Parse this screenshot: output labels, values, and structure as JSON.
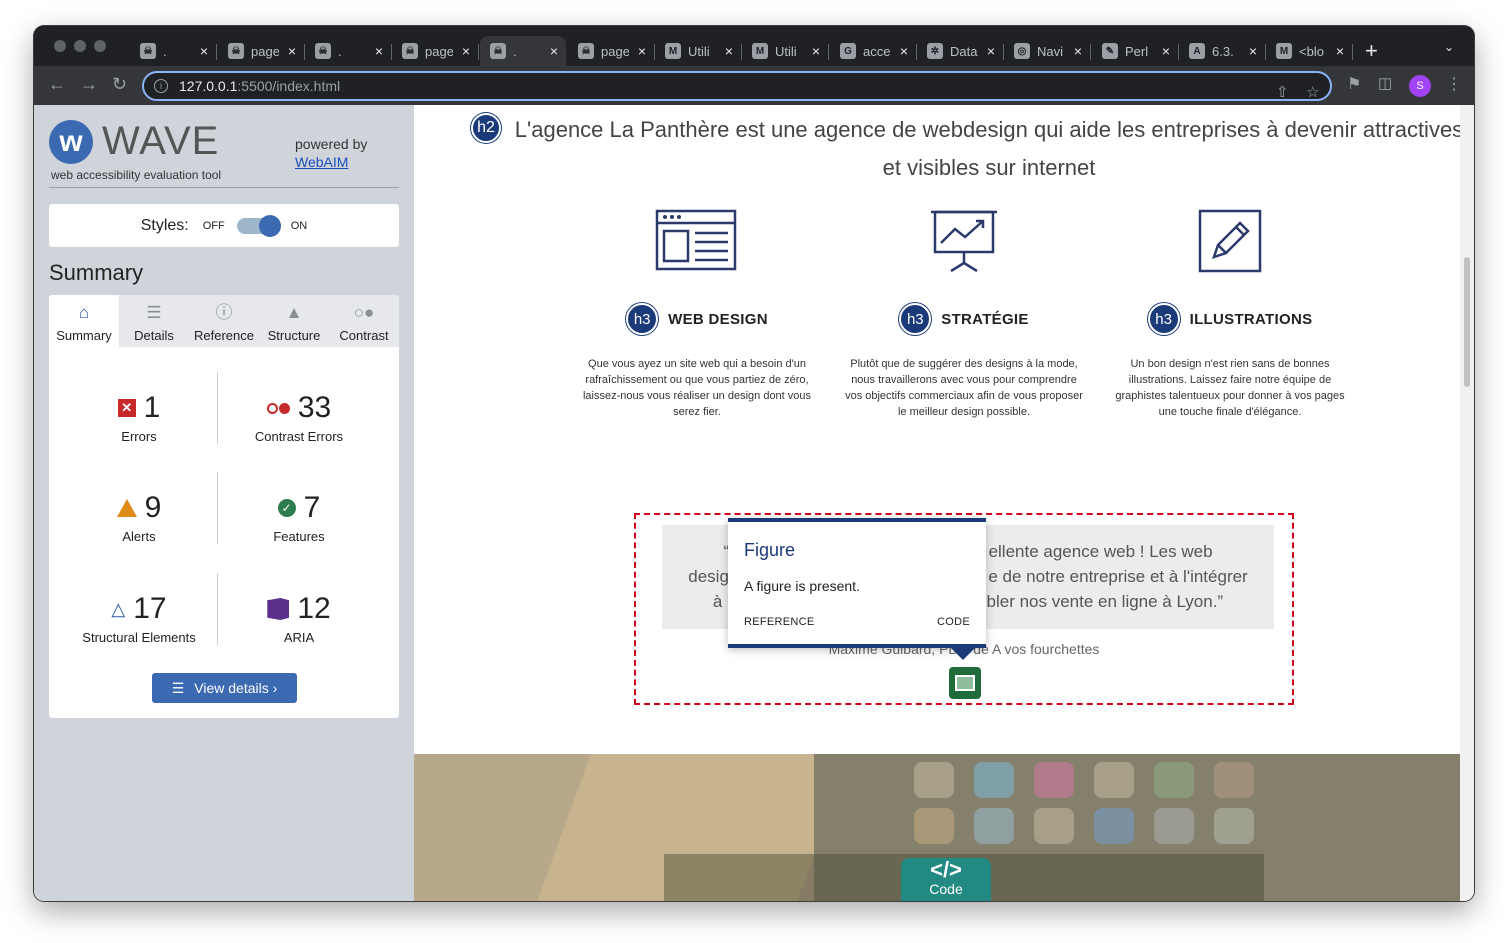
{
  "browser": {
    "tabs": [
      {
        "label": ".",
        "favicon": "skull-icon"
      },
      {
        "label": "page",
        "favicon": "skull-icon"
      },
      {
        "label": ".",
        "favicon": "skull-icon"
      },
      {
        "label": "page",
        "favicon": "skull-icon"
      },
      {
        "label": ".",
        "favicon": "skull-icon",
        "active": true
      },
      {
        "label": "page",
        "favicon": "skull-icon"
      },
      {
        "label": "Utili",
        "favicon": "m-icon"
      },
      {
        "label": "Utili",
        "favicon": "m-icon"
      },
      {
        "label": "acce",
        "favicon": "google-icon"
      },
      {
        "label": "Data",
        "favicon": "puzzle-icon"
      },
      {
        "label": "Navi",
        "favicon": "globe-icon"
      },
      {
        "label": "Perl",
        "favicon": "feather-icon"
      },
      {
        "label": "6.3.",
        "favicon": "a-icon"
      },
      {
        "label": "<blo",
        "favicon": "m-icon"
      }
    ],
    "url_host": "127.0.0.1",
    "url_path": ":5500/index.html",
    "profile_initial": "S"
  },
  "wave": {
    "logo": "WAVE",
    "subtitle": "web accessibility evaluation tool",
    "powered_by": "powered by",
    "webaim": "WebAIM",
    "styles_label": "Styles:",
    "off": "OFF",
    "on": "ON",
    "summary_title": "Summary",
    "tabs": [
      "Summary",
      "Details",
      "Reference",
      "Structure",
      "Contrast"
    ],
    "stats": {
      "errors": {
        "count": "1",
        "label": "Errors"
      },
      "contrast": {
        "count": "33",
        "label": "Contrast Errors"
      },
      "alerts": {
        "count": "9",
        "label": "Alerts"
      },
      "features": {
        "count": "7",
        "label": "Features"
      },
      "structural": {
        "count": "17",
        "label": "Structural Elements"
      },
      "aria": {
        "count": "12",
        "label": "ARIA"
      }
    },
    "view_details": "View details ›"
  },
  "page": {
    "h2_badge": "h2",
    "hero_line1": "L'agence La Panthère est une agence de webdesign qui aide les entreprises à devenir attractives",
    "hero_line2": "et visibles sur internet",
    "services": [
      {
        "badge": "h3",
        "title": "WEB DESIGN",
        "desc": "Que vous ayez un site web qui a besoin d'un rafraîchissement ou que vous partiez de zéro, laissez-nous vous réaliser un design dont vous serez fier."
      },
      {
        "badge": "h3",
        "title": "STRATÉGIE",
        "desc": "Plutôt que de suggérer des designs à la mode, nous travaillerons avec vous pour comprendre vos objectifs commerciaux afin de vous proposer le meilleur design possible."
      },
      {
        "badge": "h3",
        "title": "ILLUSTRATIONS",
        "desc": "Un bon design n'est rien sans de bonnes illustrations. Laissez faire notre équipe de graphistes talentueux pour donner à vos pages une touche finale d'élégance."
      }
    ],
    "quote_l1a": "“L",
    "quote_l1b": "ellente agence web ! Les web",
    "quote_l2a": "design",
    "quote_l2b": "e de notre entreprise et à l'intégrer",
    "quote_l3a": "à n",
    "quote_l3b": "bler nos vente en ligne à Lyon.”",
    "author": "Maxime Guibard, PDG de A vos fourchettes",
    "tooltip": {
      "title": "Figure",
      "body": "A figure is present.",
      "reference": "REFERENCE",
      "code": "CODE"
    },
    "code_tab": {
      "symbol": "</>",
      "label": "Code"
    }
  },
  "colors": {
    "wave_blue": "#3b6ab3",
    "badge_navy": "#1b3a7a",
    "error_red": "#c62a2a",
    "figure_green": "#1f6b39",
    "code_teal": "#228a82"
  }
}
